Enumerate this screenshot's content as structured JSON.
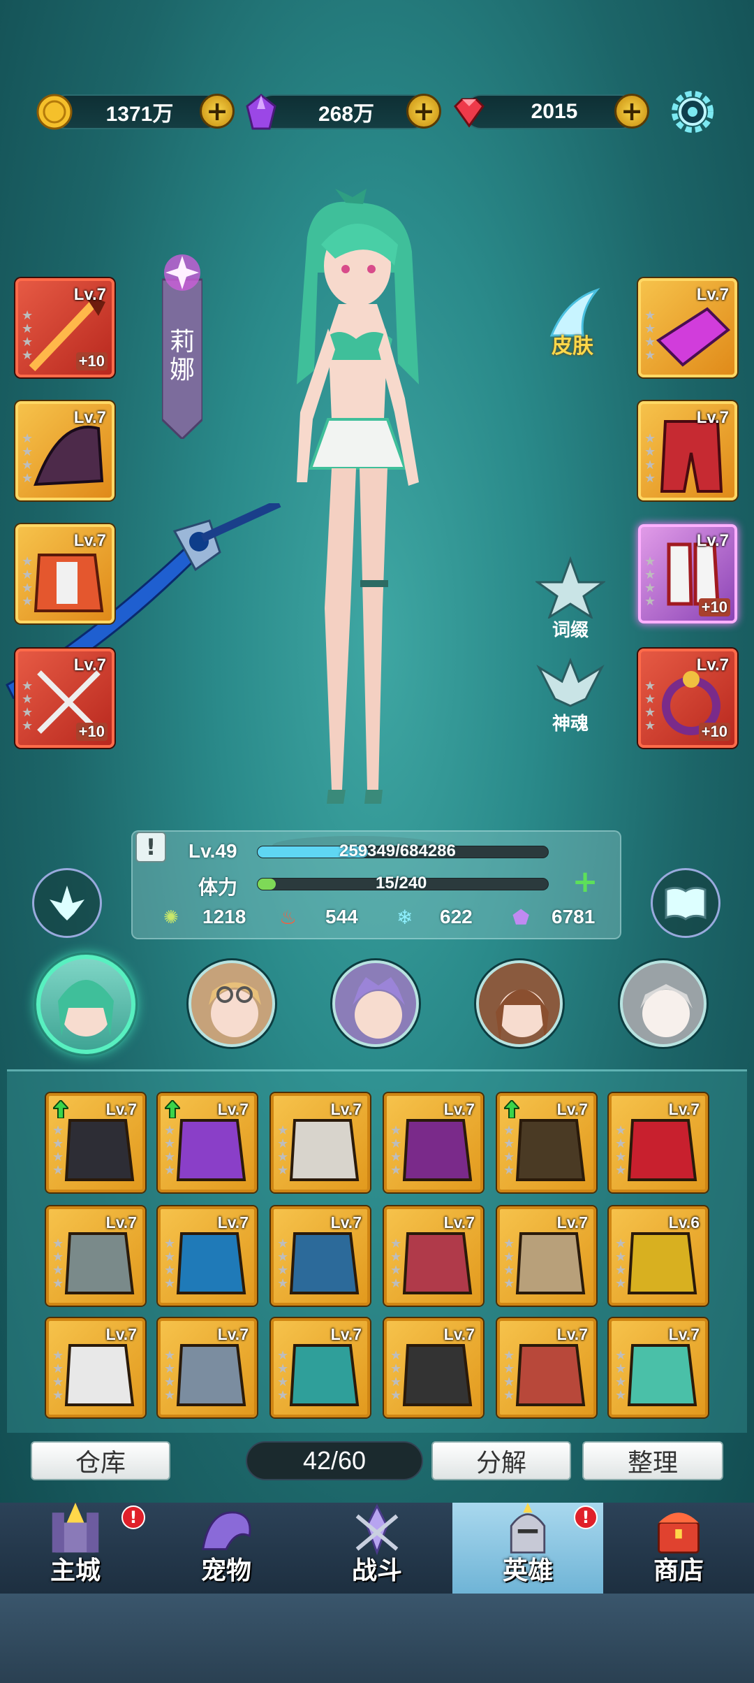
{
  "currency": {
    "gold": "1371万",
    "crystal": "268万",
    "gem": "2015"
  },
  "hero": {
    "name_line1": "莉",
    "name_line2": "娜",
    "skin_label": "皮肤",
    "affix_label": "词缀",
    "soul_label": "神魂"
  },
  "equipment_left": [
    {
      "lv": "Lv.7",
      "plus": "+10"
    },
    {
      "lv": "Lv.7",
      "plus": ""
    },
    {
      "lv": "Lv.7",
      "plus": ""
    },
    {
      "lv": "Lv.7",
      "plus": "+10"
    }
  ],
  "equipment_right": [
    {
      "lv": "Lv.7",
      "plus": ""
    },
    {
      "lv": "Lv.7",
      "plus": ""
    },
    {
      "lv": "Lv.7",
      "plus": "+10"
    },
    {
      "lv": "Lv.7",
      "plus": "+10"
    }
  ],
  "stats": {
    "level": "Lv.49",
    "exp": "259349/684286",
    "exp_fraction": 0.379,
    "stamina_label": "体力",
    "stamina": "15/240",
    "stamina_fraction": 0.0625,
    "attr1": "1218",
    "attr2": "544",
    "attr3": "622",
    "attr4": "6781"
  },
  "bag": {
    "items": [
      "Lv.7",
      "Lv.7",
      "Lv.7",
      "Lv.7",
      "Lv.7",
      "Lv.7",
      "Lv.7",
      "Lv.7",
      "Lv.7",
      "Lv.7",
      "Lv.7",
      "Lv.6",
      "Lv.7",
      "Lv.7",
      "Lv.7",
      "Lv.7",
      "Lv.7",
      "Lv.7"
    ],
    "warehouse": "仓库",
    "count": "42/60",
    "decompose": "分解",
    "sort": "整理"
  },
  "nav": {
    "main_city": "主城",
    "pet": "宠物",
    "battle": "战斗",
    "hero": "英雄",
    "shop": "商店"
  },
  "colors": {
    "accent_green": "#58f0c0",
    "exp_bar": "#5fd6f3",
    "stamina_bar": "#7ed957"
  }
}
